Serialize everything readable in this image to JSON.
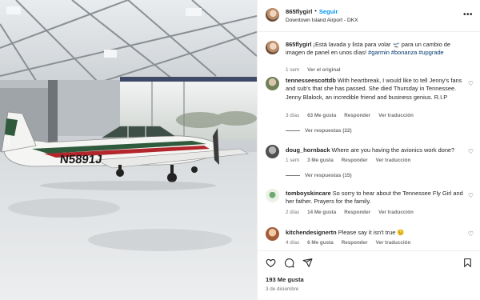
{
  "post": {
    "username": "865flygirl",
    "follow_label": "Seguir",
    "separator": "•",
    "location": "Downtown Island Airport - DKX"
  },
  "caption": {
    "username": "865flygirl",
    "text": "¡Está lavada y lista para volar 🛫 para un cambio de imagen de panel en unos días!",
    "hashtags": "#garmin #bonanza #upgrade",
    "time": "1 sem",
    "translate": "Ver el original"
  },
  "aircraft": {
    "registration": "N5891J"
  },
  "comments": [
    {
      "username": "tennesseescottdb",
      "text": "With heartbreak, I would like to tell Jenny's fans and sub's that she has passed. She died Thursday in Tennessee. Jenny Blalock, an incredible friend and business genius. R.I.P",
      "time": "3 días",
      "likes": "63 Me gusta",
      "reply": "Responder",
      "translate": "Ver traducción",
      "view_replies": "Ver respuestas (22)"
    },
    {
      "username": "doug_hornback",
      "text": "Where are you having the avionics work done?",
      "time": "1 sem",
      "likes": "3 Me gusta",
      "reply": "Responder",
      "translate": "Ver traducción",
      "view_replies": "Ver respuestas (15)"
    },
    {
      "username": "tomboyskincare",
      "text": "So sorry to hear about the Tennessee Fly Girl and her father. Prayers for the family.",
      "time": "2 días",
      "likes": "14 Me gusta",
      "reply": "Responder",
      "translate": "Ver traducción"
    },
    {
      "username": "kitchendesignertn",
      "text": "Please say it isn't true 😟",
      "time": "4 días",
      "likes": "6 Me gusta",
      "reply": "Responder",
      "translate": "Ver traducción"
    }
  ],
  "footer": {
    "likes": "193 Me gusta",
    "date": "3 de diciembre"
  },
  "icons": {
    "heart": "heart-icon",
    "comment": "comment-icon",
    "share": "share-icon",
    "bookmark": "bookmark-icon",
    "more": "more-icon"
  },
  "colors": {
    "follow_blue": "#0095f6",
    "hashtag": "#00376b",
    "muted": "#737373",
    "aircraft_stripe_red": "#b3262c",
    "aircraft_stripe_green": "#2f5a3c"
  }
}
